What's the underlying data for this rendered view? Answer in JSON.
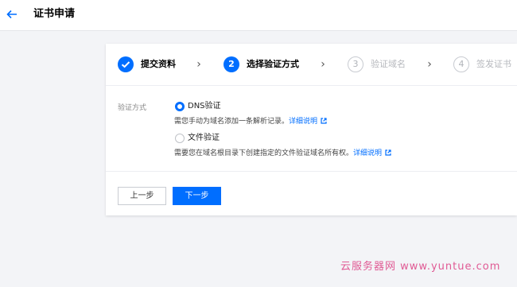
{
  "header": {
    "back_icon": "arrow-left-icon",
    "title": "证书申请"
  },
  "steps": [
    {
      "num": "✓",
      "label": "提交资料",
      "status": "done"
    },
    {
      "num": "2",
      "label": "选择验证方式",
      "status": "active"
    },
    {
      "num": "3",
      "label": "验证域名",
      "status": "pending"
    },
    {
      "num": "4",
      "label": "签发证书",
      "status": "pending"
    }
  ],
  "form": {
    "label": "验证方式",
    "options": [
      {
        "label": "DNS验证",
        "checked": true,
        "desc": "需您手动为域名添加一条解析记录。",
        "link": "详细说明"
      },
      {
        "label": "文件验证",
        "checked": false,
        "desc": "需要您在域名根目录下创建指定的文件验证域名所有权。",
        "link": "详细说明"
      }
    ]
  },
  "buttons": {
    "prev": "上一步",
    "next": "下一步"
  },
  "watermark": "云服务器网 www.yuntue.com",
  "colors": {
    "accent": "#006eff",
    "watermark": "#e05a94"
  }
}
